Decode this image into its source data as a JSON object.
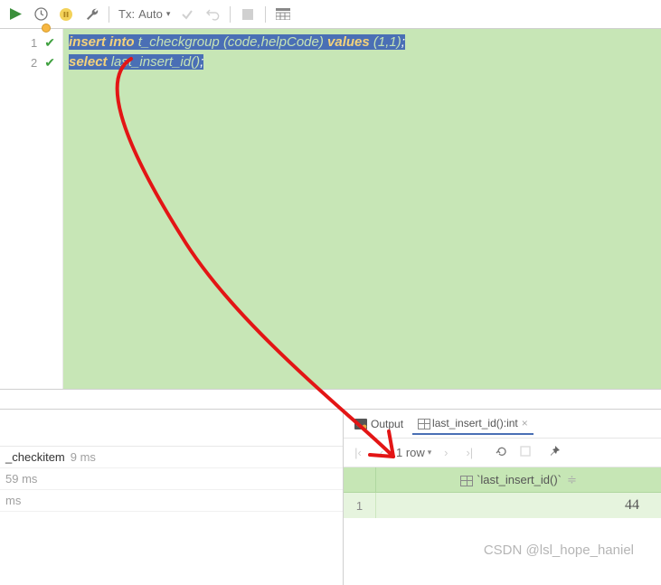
{
  "toolbar": {
    "tx_label": "Tx:",
    "tx_value": "Auto"
  },
  "gutter": {
    "lines": [
      "1",
      "2"
    ]
  },
  "code": {
    "line1": {
      "kw1": "insert",
      "kw2": "into",
      "ident": "t_checkgroup",
      "paren": "(code,helpCode)",
      "kw3": "values",
      "vals": "(1,1)",
      "semi": ";"
    },
    "line2": {
      "kw1": "select",
      "fn": "last_insert_id()",
      "semi": ";"
    }
  },
  "left_panel": {
    "item1_name": "_checkitem",
    "item1_time": "9 ms",
    "item2_time": "59 ms",
    "item3_time": "ms"
  },
  "tabs": {
    "output_label": "Output",
    "result_label": "last_insert_id():int"
  },
  "nav": {
    "row_count": "1 row"
  },
  "grid": {
    "col_header": "`last_insert_id()`",
    "row1_num": "1",
    "row1_val": "44"
  },
  "watermark": "CSDN @lsl_hope_haniel"
}
